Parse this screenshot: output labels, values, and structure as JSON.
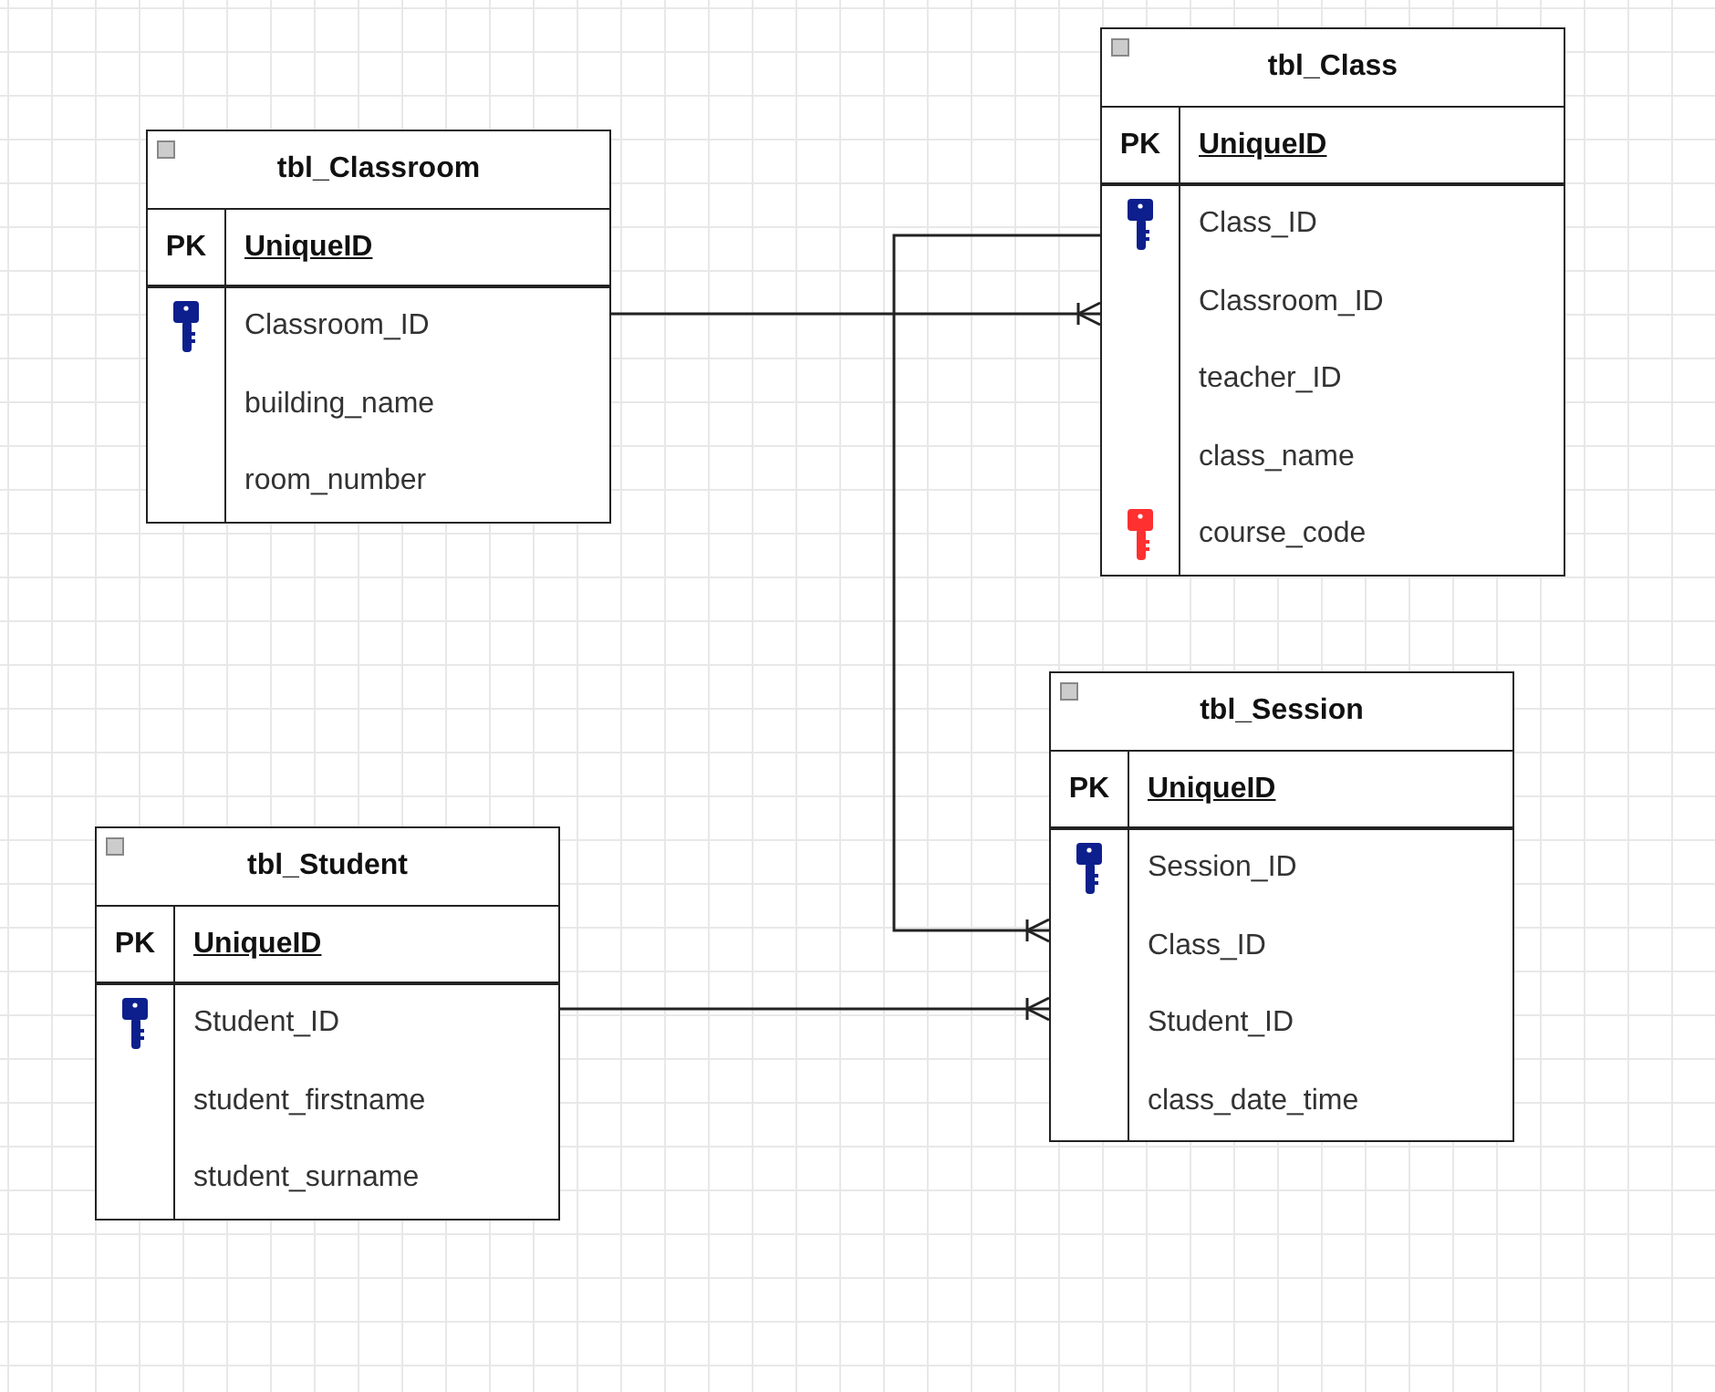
{
  "tables": [
    {
      "name": "tbl_Classroom",
      "pk_label": "PK",
      "pk_field": "UniqueID",
      "rows": [
        {
          "field": "Classroom_ID",
          "kind": "primary"
        },
        {
          "field": "building_name",
          "kind": "plain"
        },
        {
          "field": "room_number",
          "kind": "plain"
        }
      ]
    },
    {
      "name": "tbl_Class",
      "pk_label": "PK",
      "pk_field": "UniqueID",
      "rows": [
        {
          "field": "Class_ID",
          "kind": "primary"
        },
        {
          "field": "Classroom_ID",
          "kind": "plain"
        },
        {
          "field": "teacher_ID",
          "kind": "plain"
        },
        {
          "field": "class_name",
          "kind": "plain"
        },
        {
          "field": "course_code",
          "kind": "foreign"
        }
      ]
    },
    {
      "name": "tbl_Session",
      "pk_label": "PK",
      "pk_field": "UniqueID",
      "rows": [
        {
          "field": "Session_ID",
          "kind": "primary"
        },
        {
          "field": "Class_ID",
          "kind": "plain"
        },
        {
          "field": "Student_ID",
          "kind": "plain"
        },
        {
          "field": "class_date_time",
          "kind": "plain"
        }
      ]
    },
    {
      "name": "tbl_Student",
      "pk_label": "PK",
      "pk_field": "UniqueID",
      "rows": [
        {
          "field": "Student_ID",
          "kind": "primary"
        },
        {
          "field": "student_firstname",
          "kind": "plain"
        },
        {
          "field": "student_surname",
          "kind": "plain"
        }
      ]
    }
  ],
  "relationships": [
    {
      "kind": "many"
    },
    {
      "kind": "many"
    },
    {
      "kind": "many"
    }
  ]
}
